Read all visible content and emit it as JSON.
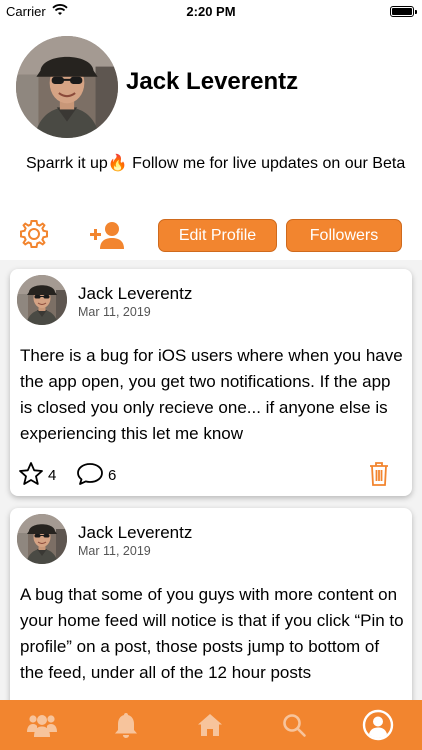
{
  "status_bar": {
    "carrier": "Carrier",
    "time": "2:20 PM",
    "battery_level": 0.9
  },
  "profile": {
    "name": "Jack Leverentz",
    "bio": "Sparrk it up🔥 Follow me for live updates on our Beta",
    "settings_icon": "gear-icon",
    "add_friend_icon": "add-person-icon",
    "edit_profile_label": "Edit Profile",
    "followers_label": "Followers"
  },
  "posts": [
    {
      "author": "Jack Leverentz",
      "date": "Mar 11, 2019",
      "body": "There is a bug for iOS users where when you have the app open, you get two notifications. If the app is closed you only recieve one... if anyone else is experiencing this let me know",
      "likes": "4",
      "comments": "6"
    },
    {
      "author": "Jack Leverentz",
      "date": "Mar 11, 2019",
      "body": "A bug that some of you guys with more content on your home feed will notice is that if you click “Pin to profile” on a post, those posts jump to bottom of the feed, under all of the 12 hour posts"
    }
  ],
  "tab_bar": {
    "items": [
      "people-icon",
      "bell-icon",
      "home-icon",
      "search-icon",
      "profile-icon"
    ],
    "active": "profile-icon"
  },
  "colors": {
    "accent": "#f2852f",
    "accent_dark": "#cf6a1d",
    "icon_inactive": "#f7c49c"
  }
}
